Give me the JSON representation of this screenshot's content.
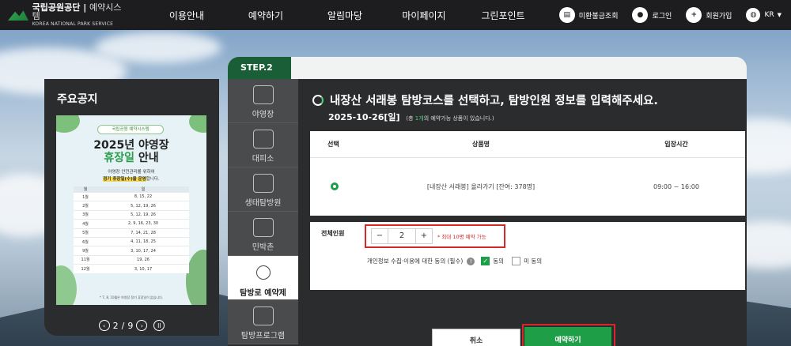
{
  "header": {
    "logo_main": "국립공원공단",
    "logo_sub": "예약시스템",
    "logo_en": "KOREA NATIONAL PARK SERVICE",
    "nav": [
      "이용안내",
      "예약하기",
      "알림마당",
      "마이페이지",
      "그린포인트"
    ],
    "util": [
      {
        "label": "미환불금조회",
        "icon": "receipt-icon"
      },
      {
        "label": "로그인",
        "icon": "user-icon"
      },
      {
        "label": "회원가입",
        "icon": "add-user-icon"
      },
      {
        "label": "KR",
        "icon": "globe-icon"
      }
    ]
  },
  "notice": {
    "title": "주요공지",
    "poster": {
      "badge": "국립공원 예약시스템",
      "title_line1": "2025년 야영장",
      "title_highlight": "휴장일",
      "title_rest": " 안내",
      "desc_line1": "야영장 안전관리를 위하여",
      "desc_highlight": "정기 휴장일(수)을 운영",
      "desc_suffix": "합니다.",
      "table_headers": [
        "월",
        "일"
      ],
      "rows": [
        [
          "1월",
          "8, 15, 22"
        ],
        [
          "2월",
          "5, 12, 19, 26"
        ],
        [
          "3월",
          "5, 12, 19, 26"
        ],
        [
          "4월",
          "2, 9, 16, 23, 30"
        ],
        [
          "5월",
          "7, 14, 21, 28"
        ],
        [
          "6월",
          "4, 11, 18, 25"
        ],
        [
          "9월",
          "3, 10, 17, 24"
        ],
        [
          "11월",
          "19, 26"
        ],
        [
          "12월",
          "3, 10, 17"
        ]
      ],
      "foot": "* 7, 8, 10월은 야영장 정기 휴장일이 없습니다."
    },
    "pager": {
      "current": "2",
      "separator": "/",
      "total": "9"
    }
  },
  "main": {
    "step": "STEP.2",
    "menu": [
      {
        "label": "야영장",
        "active": false
      },
      {
        "label": "대피소",
        "active": false
      },
      {
        "label": "생태탐방원",
        "active": false
      },
      {
        "label": "민박촌",
        "active": false
      },
      {
        "label": "탐방로 예약제",
        "active": true
      },
      {
        "label": "탐방프로그램",
        "active": false
      }
    ],
    "heading": "내장산 서래봉 탐방코스를 선택하고, 탐방인원 정보를 입력해주세요.",
    "date": "2025-10-26[일]",
    "count_prefix": "(총 ",
    "count_value": "1개",
    "count_suffix": "의 예약가능 상품이 있습니다.)",
    "table": {
      "headers": [
        "선택",
        "상품명",
        "입장시간"
      ],
      "row": {
        "product": "[내장산 서래봉] 올라가기 [잔여: 378명]",
        "time": "09:00 ~ 16:00"
      }
    },
    "form": {
      "people_label": "전체인원",
      "qty_value": "2",
      "minus": "−",
      "plus": "+",
      "max_note": "* 최대 10명 예약 가능",
      "consent_label": "개인정보 수집·이용에 대한 동의 (필수)",
      "agree": "동의",
      "disagree": "미 동의"
    },
    "buttons": {
      "cancel": "취소",
      "reserve": "예약하기"
    }
  }
}
